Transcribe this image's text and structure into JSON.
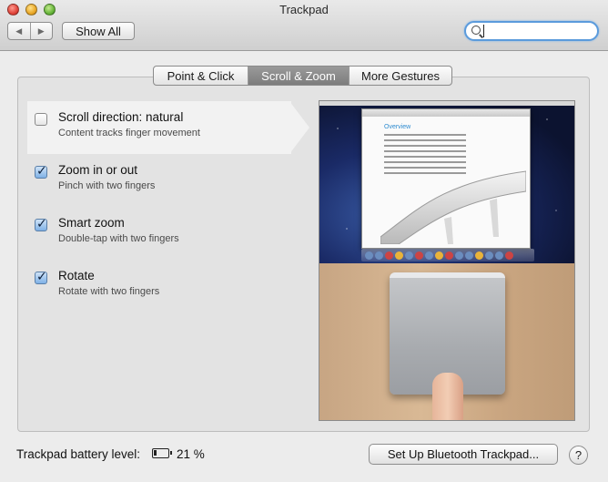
{
  "window": {
    "title": "Trackpad"
  },
  "toolbar": {
    "back_icon": "chevron-left-icon",
    "forward_icon": "chevron-right-icon",
    "back_glyph": "◀",
    "forward_glyph": "▶",
    "show_all_label": "Show All",
    "search_placeholder": ""
  },
  "tabs": [
    {
      "label": "Point & Click",
      "active": false
    },
    {
      "label": "Scroll & Zoom",
      "active": true
    },
    {
      "label": "More Gestures",
      "active": false
    }
  ],
  "options": [
    {
      "title": "Scroll direction: natural",
      "subtitle": "Content tracks finger movement",
      "checked": false,
      "selected": true
    },
    {
      "title": "Zoom in or out",
      "subtitle": "Pinch with two fingers",
      "checked": true,
      "selected": false
    },
    {
      "title": "Smart zoom",
      "subtitle": "Double-tap with two fingers",
      "checked": true,
      "selected": false
    },
    {
      "title": "Rotate",
      "subtitle": "Rotate with two fingers",
      "checked": true,
      "selected": false
    }
  ],
  "preview": {
    "document_heading": "Overview"
  },
  "footer": {
    "battery_label": "Trackpad battery level:",
    "battery_percent_text": "21 %",
    "battery_level": 0.21,
    "bluetooth_button_label": "Set Up Bluetooth Trackpad...",
    "help_label": "?"
  },
  "colors": {
    "active_tab": "#8a8a8a",
    "focus_ring": "#5b9bdc",
    "checkbox_checked": "#7fb1e6"
  }
}
